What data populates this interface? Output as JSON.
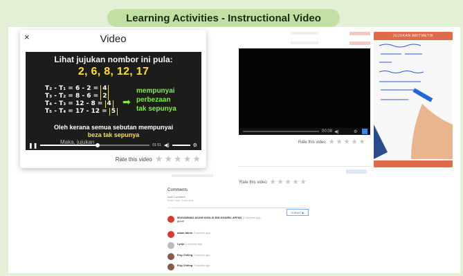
{
  "banner": {
    "title": "Learning Activities - Instructional Video"
  },
  "modal": {
    "title": "Video",
    "close_label": "×",
    "rate_label": "Rate this video",
    "stars": 5
  },
  "video": {
    "line1": "Lihat jujukan nombor ini pula:",
    "sequence": "2, 6, 8, 12, 17",
    "equations": [
      {
        "lhs": "T₂ - T₁ = 6 - 2 =",
        "res": "4"
      },
      {
        "lhs": "T₃ - T₂ = 8 - 6 =",
        "res": "2"
      },
      {
        "lhs": "T₄ - T₃ = 12 - 8 =",
        "res": "4"
      },
      {
        "lhs": "T₅ - T₄ = 17 - 12 =",
        "res": "5"
      }
    ],
    "side": [
      "mempunyai",
      "perbezaan",
      "tak sepunya"
    ],
    "foot1": "Oleh kerana semua sebutan mempunyai",
    "foot2": "beza tak sepunya",
    "caption": "Maka, jujukan",
    "time": "01:51",
    "progress": 0.52,
    "volume": 0.85
  },
  "background": {
    "rate_label_1": "Rate this video",
    "rate_label_2": "Rate this video",
    "video_time": "00:08"
  },
  "board": {
    "header": "JUJUKAN ARITMETIK"
  },
  "comments": {
    "title": "Comments",
    "add_label": "Add Comment",
    "placeholder": "Enter Your Comment",
    "submit": "SUBMIT ▶",
    "items": [
      {
        "name": "MUHAMMAD ADAM KHALID BIN KHAIRIL AFFAN",
        "time": "10 months ago",
        "text": "good!",
        "avatar": "red"
      },
      {
        "name": "adam fakrin",
        "time": "3 months ago",
        "text": "",
        "avatar": "red"
      },
      {
        "name": "Lynjo",
        "time": "3 months ago",
        "text": "",
        "avatar": "grey"
      },
      {
        "name": "Eng Chiling",
        "time": "3 months ago",
        "text": "",
        "avatar": "photo"
      },
      {
        "name": "Eng Chiling",
        "time": "3 months ago",
        "text": "",
        "avatar": "photo"
      }
    ]
  },
  "colors": {
    "banner_bg": "#c3e0a4",
    "frame_bg": "#e4f0d6",
    "accent_green": "#7df03c",
    "accent_yellow": "#ffe028"
  }
}
